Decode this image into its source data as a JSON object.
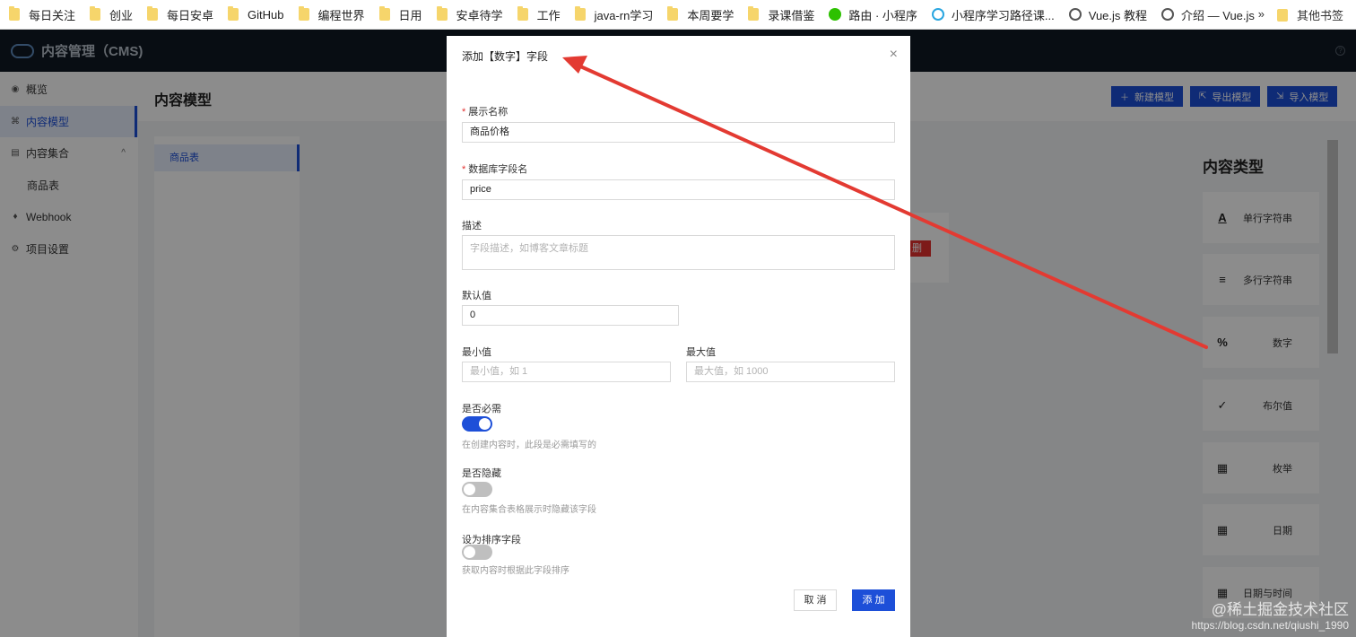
{
  "bookmarks": {
    "items": [
      {
        "label": "每日关注",
        "icon": "folder-icon"
      },
      {
        "label": "创业",
        "icon": "folder-icon"
      },
      {
        "label": "每日安卓",
        "icon": "folder-icon"
      },
      {
        "label": "GitHub",
        "icon": "folder-icon"
      },
      {
        "label": "编程世界",
        "icon": "folder-icon"
      },
      {
        "label": "日用",
        "icon": "folder-icon"
      },
      {
        "label": "安卓待学",
        "icon": "folder-icon"
      },
      {
        "label": "工作",
        "icon": "folder-icon"
      },
      {
        "label": "java-rn学习",
        "icon": "folder-icon"
      },
      {
        "label": "本周要学",
        "icon": "folder-icon"
      },
      {
        "label": "录课借鉴",
        "icon": "folder-icon"
      },
      {
        "label": "路由 · 小程序",
        "icon": "wechat-icon"
      },
      {
        "label": "小程序学习路径课...",
        "icon": "cloud-icon"
      },
      {
        "label": "Vue.js 教程",
        "icon": "globe-icon"
      },
      {
        "label": "介绍 — Vue.js",
        "icon": "globe-icon"
      }
    ],
    "more": "»",
    "other": "其他书签"
  },
  "app": {
    "title": "内容管理（CMS)",
    "help": "?"
  },
  "sidebar": {
    "items": [
      {
        "label": "概览",
        "icon": "eye-icon",
        "glyph": "◉"
      },
      {
        "label": "内容模型",
        "icon": "model-icon",
        "glyph": "⌘"
      },
      {
        "label": "内容集合",
        "icon": "collection-icon",
        "glyph": "▤",
        "caret": "^"
      },
      {
        "label": "商品表"
      },
      {
        "label": "Webhook",
        "icon": "bell-icon",
        "glyph": "♦"
      },
      {
        "label": "项目设置",
        "icon": "gear-icon",
        "glyph": "⚙"
      }
    ]
  },
  "main": {
    "page_title": "内容模型",
    "buttons": {
      "new_model": "新建模型",
      "export_model": "导出模型",
      "import_model": "导入模型"
    },
    "models": [
      "商品表"
    ],
    "delete_fragment": "删除"
  },
  "types": {
    "title": "内容类型",
    "items": [
      {
        "label": "单行字符串",
        "icon": "text-a-icon",
        "glyph": "A"
      },
      {
        "label": "多行字符串",
        "icon": "lines-icon",
        "glyph": "≡"
      },
      {
        "label": "数字",
        "icon": "percent-icon",
        "glyph": "%"
      },
      {
        "label": "布尔值",
        "icon": "check-icon",
        "glyph": "✓"
      },
      {
        "label": "枚举",
        "icon": "enum-icon",
        "glyph": "▦"
      },
      {
        "label": "日期",
        "icon": "calendar-icon",
        "glyph": "▦"
      },
      {
        "label": "日期与时间",
        "icon": "calendar-time-icon",
        "glyph": "▦"
      }
    ]
  },
  "modal": {
    "title": "添加【数字】字段",
    "close": "×",
    "display_name": {
      "label": "展示名称",
      "value": "商品价格"
    },
    "db_field": {
      "label": "数据库字段名",
      "value": "price"
    },
    "description": {
      "label": "描述",
      "placeholder": "字段描述，如博客文章标题"
    },
    "default_value": {
      "label": "默认值",
      "value": "0"
    },
    "min": {
      "label": "最小值",
      "placeholder": "最小值，如 1"
    },
    "max": {
      "label": "最大值",
      "placeholder": "最大值，如 1000"
    },
    "required": {
      "label": "是否必需",
      "on": true,
      "help": "在创建内容时，此段是必需填写的"
    },
    "hidden": {
      "label": "是否隐藏",
      "on": false,
      "help": "在内容集合表格展示时隐藏该字段"
    },
    "sort": {
      "label": "设为排序字段",
      "on": false,
      "help": "获取内容时根据此字段排序"
    },
    "cancel": "取 消",
    "add": "添 加"
  },
  "annotation_color": "#e33a32",
  "watermark": {
    "line1": "@稀土掘金技术社区",
    "line2": "https://blog.csdn.net/qiushi_1990"
  }
}
